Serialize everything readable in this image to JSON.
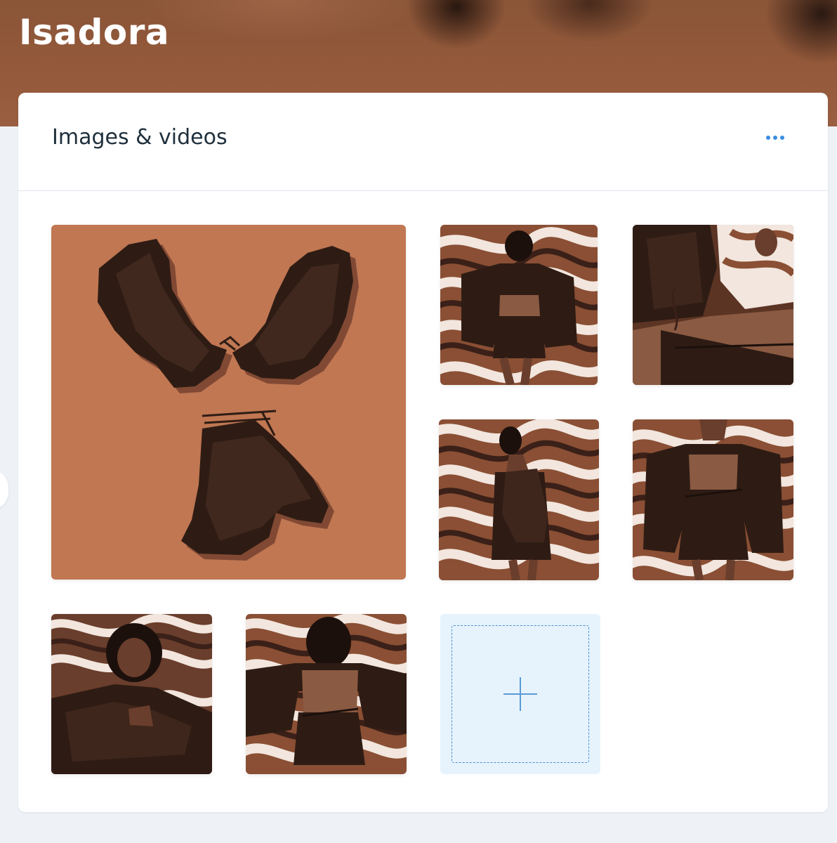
{
  "page": {
    "title": "Isadora"
  },
  "media_card": {
    "title": "Images & videos",
    "more_icon": "more-horizontal-icon",
    "add_icon": "plus-icon"
  },
  "gallery": {
    "items": [
      {
        "subject": "flat-lay-ruffle-top-and-skirt"
      },
      {
        "subject": "model-front-swirl-background"
      },
      {
        "subject": "model-closeup-tattoo-collage"
      },
      {
        "subject": "model-side-swirl-background"
      },
      {
        "subject": "model-torso-front-swirl-background"
      },
      {
        "subject": "model-seated-swirl-background"
      },
      {
        "subject": "model-back-swirl-background"
      }
    ]
  },
  "colors": {
    "accent": "#3b8ee0",
    "hero_brown": "#94593a",
    "tile_orange": "#c07752",
    "fabric_dark": "#2e1c14",
    "swirl_cream": "#f2e6de",
    "add_tile_bg": "#e6f3fd"
  }
}
